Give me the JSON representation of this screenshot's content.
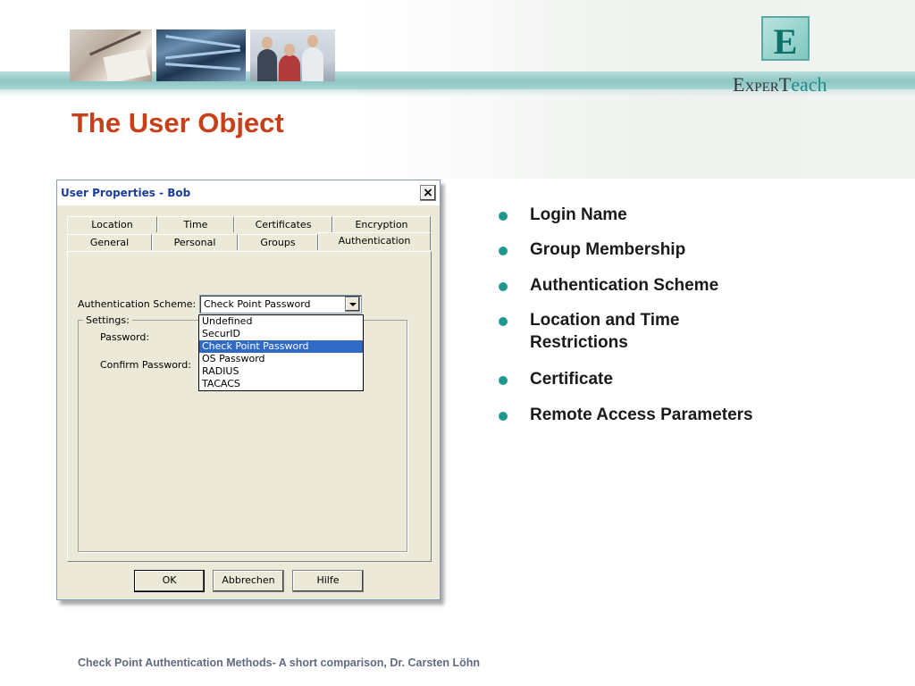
{
  "branding": {
    "logo_mark": "E",
    "logo_prefix": "ExperT",
    "logo_suffix": "each"
  },
  "slide": {
    "title": "The User Object"
  },
  "dialog": {
    "title": "User Properties - Bob",
    "close_label": "×",
    "tabs_back": [
      "Location",
      "Time",
      "Certificates",
      "Encryption"
    ],
    "tabs_front": [
      "General",
      "Personal",
      "Groups",
      "Authentication"
    ],
    "active_tab": "Authentication",
    "auth_scheme_label": "Authentication Scheme:",
    "auth_scheme_value": "Check Point Password",
    "settings_legend": "Settings:",
    "password_label": "Password:",
    "confirm_password_label": "Confirm Password:",
    "dropdown_options": [
      "Undefined",
      "SecurID",
      "Check Point Password",
      "OS Password",
      "RADIUS",
      "TACACS"
    ],
    "dropdown_selected": "Check Point Password",
    "buttons": {
      "ok": "OK",
      "cancel": "Abbrechen",
      "help": "Hilfe"
    }
  },
  "bullets": [
    "Login Name",
    "Group Membership",
    "Authentication Scheme",
    "Location and Time Restrictions",
    "Certificate",
    "Remote Access Parameters"
  ],
  "footer": {
    "text": "Check Point Authentication Methods- A short comparison,   Dr. Carsten Löhn"
  },
  "colors": {
    "title": "#c8401a",
    "bullet": "#1f9990",
    "selection": "#316ac5"
  }
}
